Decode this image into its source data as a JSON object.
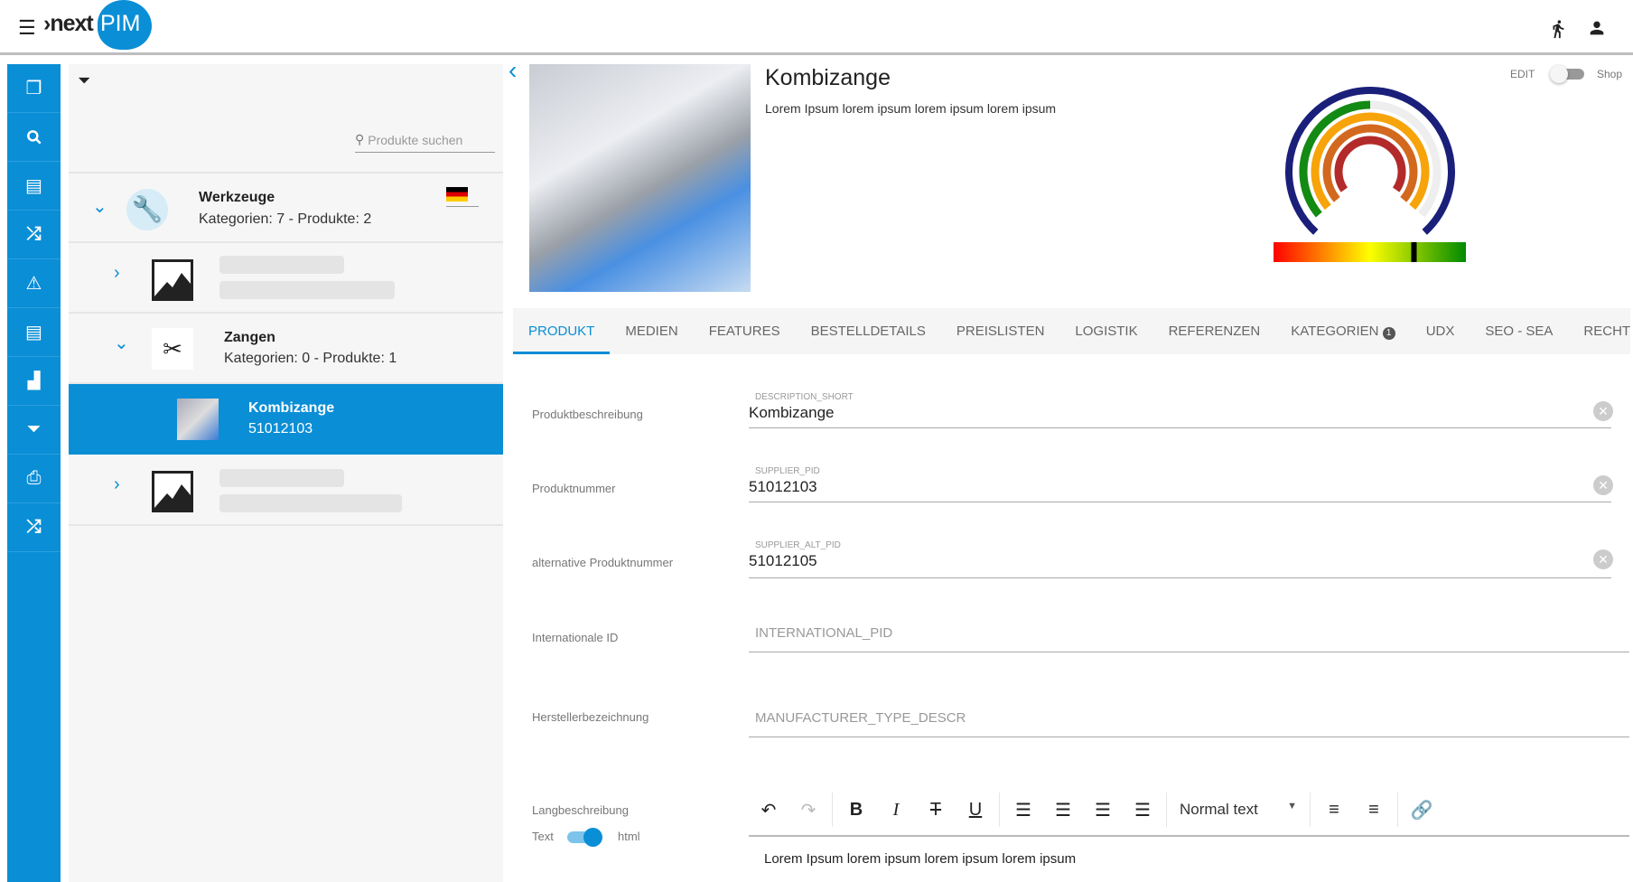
{
  "app": {
    "logo_prefix": "›next",
    "logo_suffix": "PIM",
    "brand_color": "#0a8ed6"
  },
  "header": {
    "icons": [
      "menu-icon",
      "run-icon",
      "user-icon"
    ]
  },
  "sidebar": {
    "items": [
      "copy-icon",
      "search-icon",
      "list-icon",
      "shuffle-icon",
      "warning-icon",
      "list-icon",
      "chart-icon",
      "filter-icon",
      "print-icon",
      "shuffle-icon"
    ]
  },
  "tree": {
    "search_placeholder": "Produkte suchen",
    "language": "de",
    "nodes": [
      {
        "title": "Werkzeuge",
        "subtitle": "Kategorien: 7 - Produkte: 2"
      },
      {
        "title": "Zangen",
        "subtitle": "Kategorien: 0 - Produkte: 1"
      },
      {
        "title": "Kombizange",
        "subtitle": "51012103",
        "selected": true
      }
    ]
  },
  "product": {
    "title": "Kombizange",
    "description": "Lorem Ipsum lorem ipsum lorem ipsum lorem ipsum",
    "mode_left": "EDIT",
    "mode_right": "Shop",
    "mode_shop": false
  },
  "gauge": {
    "rings": [
      {
        "color": "#1a1f7a",
        "value": 1.0
      },
      {
        "color": "#138a13",
        "value": 0.5
      },
      {
        "color": "#f7a30a",
        "value": 1.0
      },
      {
        "color": "#d2691e",
        "value": 1.0
      },
      {
        "color": "#b22a2a",
        "value": 1.0
      }
    ],
    "scale_marker": 0.73
  },
  "tabs": [
    {
      "label": "PRODUKT",
      "active": true
    },
    {
      "label": "MEDIEN"
    },
    {
      "label": "FEATURES"
    },
    {
      "label": "BESTELLDETAILS"
    },
    {
      "label": "PREISLISTEN"
    },
    {
      "label": "LOGISTIK"
    },
    {
      "label": "REFERENZEN"
    },
    {
      "label": "KATEGORIEN",
      "badge": "1"
    },
    {
      "label": "UDX"
    },
    {
      "label": "SEO - SEA"
    },
    {
      "label": "RECHT"
    }
  ],
  "form": [
    {
      "label": "Produktbeschreibung",
      "field": "DESCRIPTION_SHORT",
      "value": "Kombizange"
    },
    {
      "label": "Produktnummer",
      "field": "SUPPLIER_PID",
      "value": "51012103"
    },
    {
      "label": "alternative Produktnummer",
      "field": "SUPPLIER_ALT_PID",
      "value": "51012105"
    },
    {
      "label": "Internationale ID",
      "placeholder": "INTERNATIONAL_PID"
    },
    {
      "label": "Herstellerbezeichnung",
      "placeholder": "MANUFACTURER_TYPE_DESCR"
    }
  ],
  "long_description": {
    "label": "Langbeschreibung",
    "toggle_left": "Text",
    "toggle_right": "html",
    "html_mode": true,
    "format": "Normal text",
    "content": "Lorem Ipsum lorem ipsum lorem ipsum lorem ipsum"
  }
}
